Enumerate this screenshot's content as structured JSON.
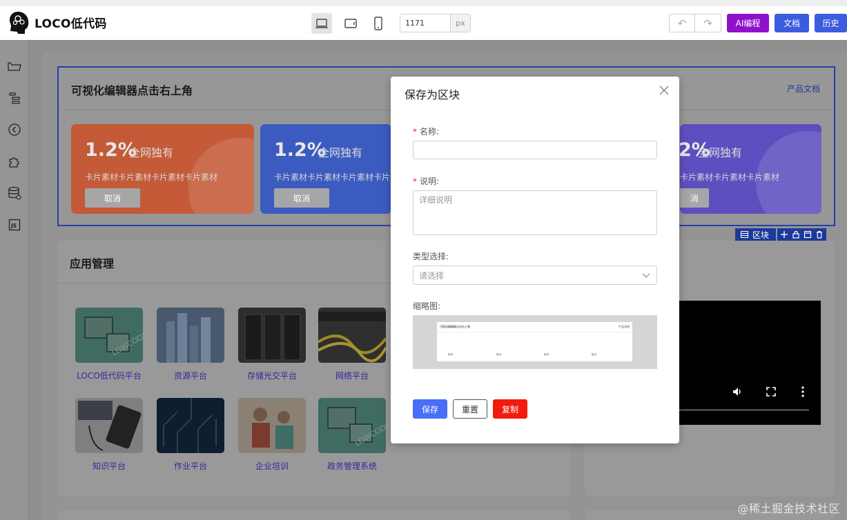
{
  "header": {
    "app_name": "LOCO低代码",
    "width_value": "1171",
    "width_unit": "px",
    "ai_button": "AI编程",
    "docs_button": "文档",
    "history_button": "历史",
    "colors": {
      "ai": "#8f11cc",
      "docs": "#3c5ce0",
      "history": "#3c5ce0"
    }
  },
  "sidebar_icons": [
    "folder-icon",
    "outline-tree-icon",
    "history-back-icon",
    "plugin-icon",
    "database-icon",
    "js-icon"
  ],
  "canvas": {
    "top_block": {
      "title": "可视化编辑器点击右上角",
      "doc_link": "产品文档",
      "cards": [
        {
          "value": "1.2%",
          "value_suffix": "全网独有",
          "desc": "卡片素材卡片素材卡片素材卡片素材",
          "button": "取消",
          "color": "#c45a38"
        },
        {
          "value": "1.2%",
          "value_suffix": "全网独有",
          "desc": "卡片素材卡片素材卡片素材卡片素材",
          "button": "取消",
          "color": "#3b5bc0"
        },
        {
          "value": "2%",
          "value_suffix": "全网独有",
          "desc": "卡片素材卡片素材卡片素材",
          "button": "消",
          "color": "#5d4fc0"
        }
      ]
    },
    "selection_toolbar": {
      "label": "区块"
    },
    "app_block": {
      "title": "应用管理",
      "apps": [
        {
          "label": "LOCO低代码平台"
        },
        {
          "label": "资源平台"
        },
        {
          "label": "存储光交平台"
        },
        {
          "label": "网络平台"
        },
        {
          "label": "知识平台"
        },
        {
          "label": "作业平台"
        },
        {
          "label": "企业培训"
        },
        {
          "label": "政务管理系统"
        }
      ]
    }
  },
  "modal": {
    "title": "保存为区块",
    "name_label": "名称:",
    "desc_label": "说明:",
    "desc_placeholder": "详细说明",
    "type_label": "类型选择:",
    "type_placeholder": "请选择",
    "thumb_label": "缩略图:",
    "thumb_preview": {
      "title": "可视化编辑器点击右上角",
      "link": "产品文档",
      "items": [
        "取消",
        "取消",
        "取消",
        "取消"
      ]
    },
    "save_button": "保存",
    "reset_button": "重置",
    "copy_button": "复制",
    "colors": {
      "save": "#4a6ef5",
      "copy": "#f21b0f",
      "required": "#e0311f"
    }
  },
  "watermark": "@稀土掘金技术社区"
}
